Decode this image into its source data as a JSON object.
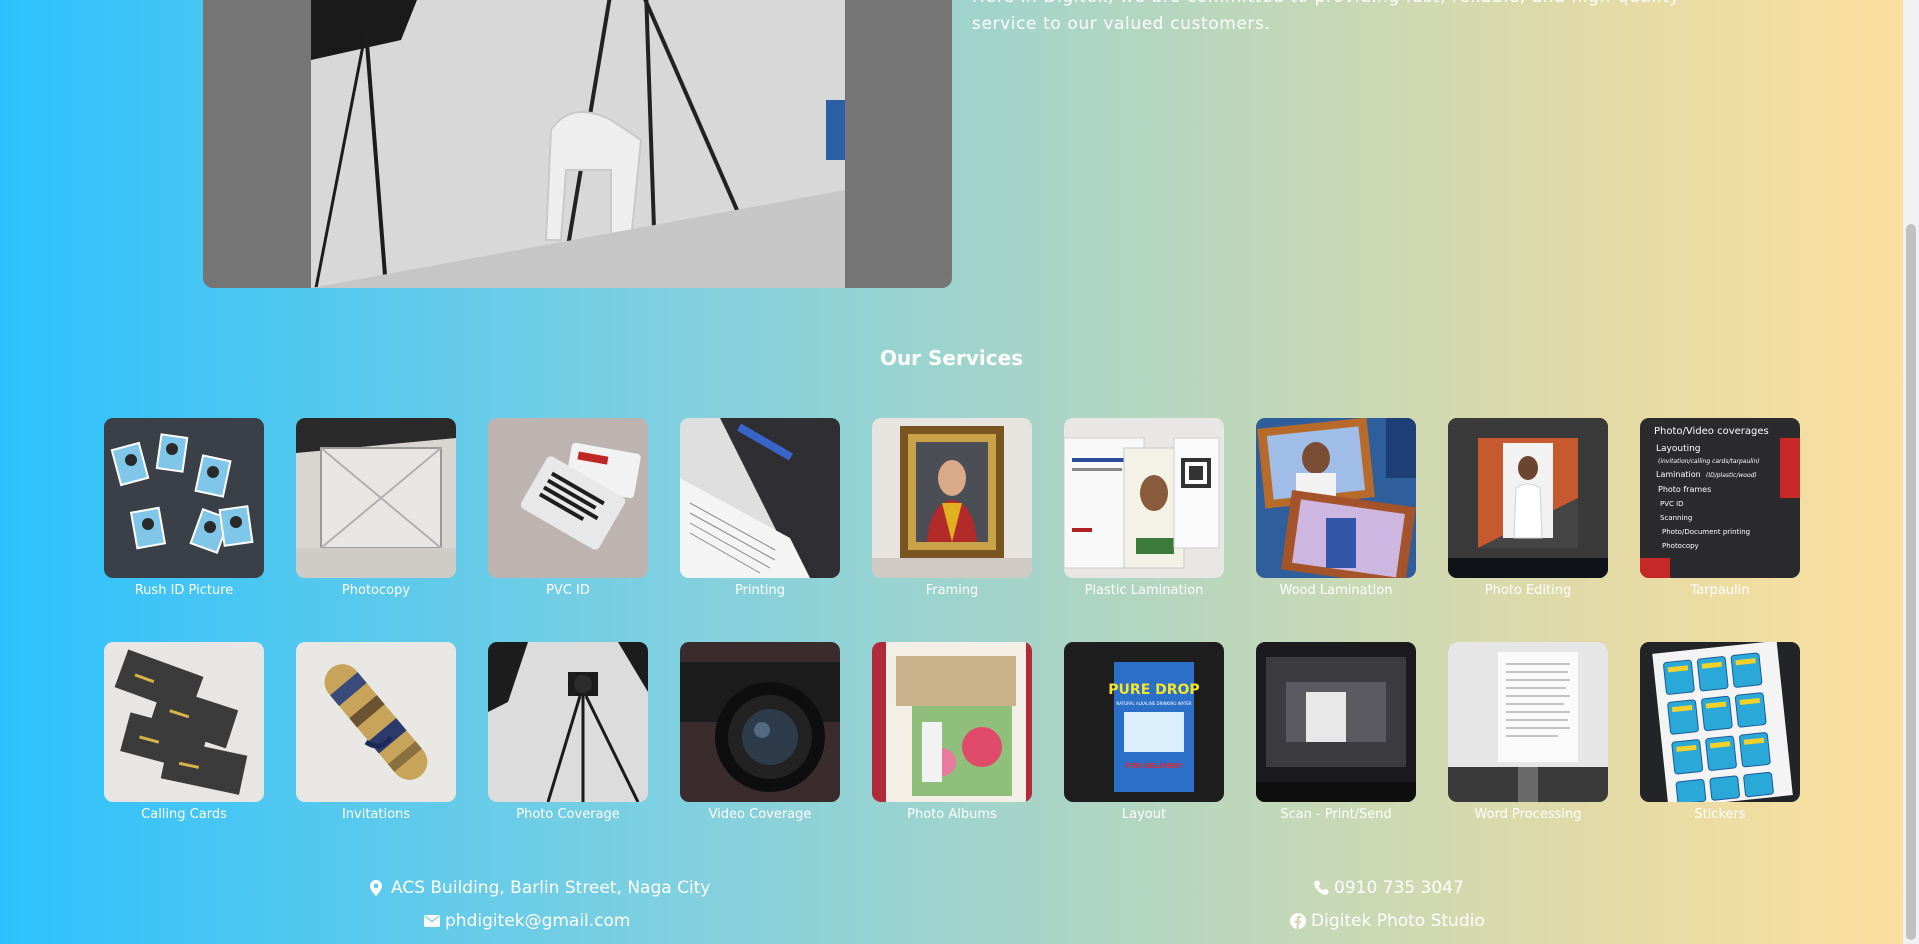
{
  "about": {
    "text_line1": "Here in Digitek, we are committed to providing fast, reliable, and high-quality",
    "text_line2": "service to our valued customers."
  },
  "services": {
    "title": "Our Services",
    "row1": [
      {
        "label": "Rush ID Picture",
        "icon": "id-photos"
      },
      {
        "label": "Photocopy",
        "icon": "photocopier"
      },
      {
        "label": "PVC ID",
        "icon": "pvc-cards"
      },
      {
        "label": "Printing",
        "icon": "printer"
      },
      {
        "label": "Framing",
        "icon": "frame"
      },
      {
        "label": "Plastic Lamination",
        "icon": "laminated-id"
      },
      {
        "label": "Wood Lamination",
        "icon": "wood-frames"
      },
      {
        "label": "Photo Editing",
        "icon": "monitor-edit"
      },
      {
        "label": "Tarpaulin",
        "icon": "signboard"
      }
    ],
    "row2": [
      {
        "label": "Calling Cards",
        "icon": "business-cards"
      },
      {
        "label": "Invitations",
        "icon": "scroll"
      },
      {
        "label": "Photo Coverage",
        "icon": "tripod-camera"
      },
      {
        "label": "Video Coverage",
        "icon": "dslr-lens"
      },
      {
        "label": "Photo Albums",
        "icon": "album"
      },
      {
        "label": "Layout",
        "icon": "poster-layout"
      },
      {
        "label": "Scan - Print/Send",
        "icon": "scanner-screen"
      },
      {
        "label": "Word Processing",
        "icon": "document-screen"
      },
      {
        "label": "Stickers",
        "icon": "sticker-sheet"
      }
    ],
    "tarpaulin_sign": {
      "heading": "Photo/Video coverages",
      "line1": "Layouting",
      "line2": "(invitation/calling cards/tarpaulin)",
      "line3": "Lamination",
      "line4": "(ID/plastic/wood)",
      "line5": "Photo frames",
      "line6": "PVC ID",
      "line7": "Scanning",
      "line8": "Photo/Document printing",
      "line9": "Photocopy"
    },
    "layout_poster": {
      "brand": "PURE DROP",
      "subtitle": "NATURAL ALKALINE DRINKING WATER",
      "tagline": "FOR DELIVERY"
    }
  },
  "contact": {
    "address": "ACS Building, Barlin Street, Naga City",
    "phone": "0910 735 3047",
    "email": "phdigitek@gmail.com",
    "facebook": "Digitek Photo Studio"
  },
  "colors": {
    "gradient_start": "#2cc1fd",
    "gradient_end": "#fddf9f",
    "text": "#ffffff"
  }
}
